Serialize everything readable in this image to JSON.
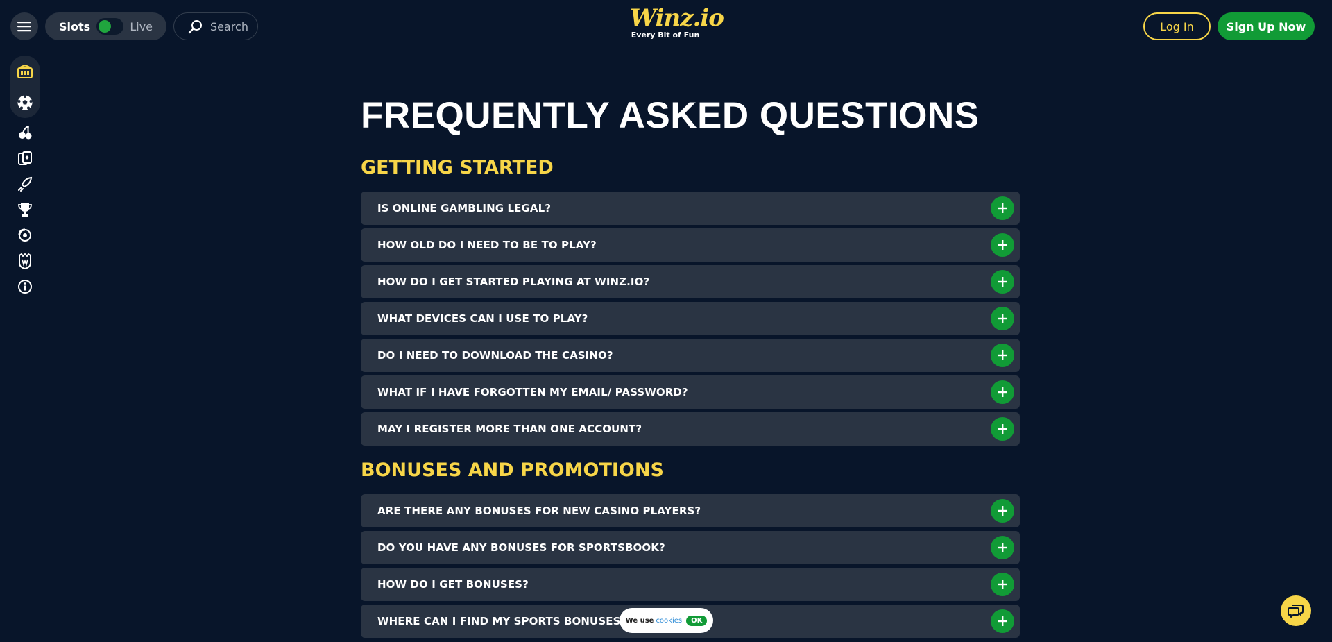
{
  "header": {
    "toggle": {
      "left_label": "Slots",
      "right_label": "Live"
    },
    "search_placeholder": "Search",
    "logo_text": "Winz.io",
    "logo_tagline": "Every Bit of Fun",
    "login_label": "Log In",
    "signup_label": "Sign Up Now"
  },
  "sidebar": {
    "pill_icons": [
      "casino-icon",
      "soccer-ball-icon"
    ],
    "icons": [
      "cherries-icon",
      "cards-icon",
      "rocket-icon",
      "trophy-icon",
      "support-icon",
      "winz-crest-icon",
      "info-icon"
    ]
  },
  "main": {
    "title": "FREQUENTLY ASKED QUESTIONS",
    "sections": [
      {
        "title": "GETTING STARTED",
        "questions": [
          "IS ONLINE GAMBLING LEGAL?",
          "HOW OLD DO I NEED TO BE TO PLAY?",
          "HOW DO I GET STARTED PLAYING AT WINZ.IO?",
          "WHAT DEVICES CAN I USE TO PLAY?",
          "DO I NEED TO DOWNLOAD THE CASINO?",
          "WHAT IF I HAVE FORGOTTEN MY EMAIL/ PASSWORD?",
          "MAY I REGISTER MORE THAN ONE ACCOUNT?"
        ]
      },
      {
        "title": "BONUSES AND PROMOTIONS",
        "questions": [
          "ARE THERE ANY BONUSES FOR NEW CASINO PLAYERS?",
          "DO YOU HAVE ANY BONUSES FOR SPORTSBOOK?",
          "HOW DO I GET BONUSES?",
          "WHERE CAN I FIND MY SPORTS BONUSES?"
        ]
      }
    ]
  },
  "cookie_bar": {
    "text": "We use",
    "link": "cookies",
    "ok": "OK"
  },
  "colors": {
    "background": "#08152a",
    "accent_yellow": "#f7d548",
    "accent_green": "#119b36",
    "panel": "#2a3443"
  }
}
